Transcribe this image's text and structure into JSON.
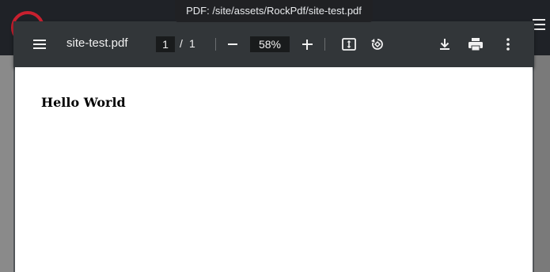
{
  "tooltip": {
    "text": "PDF: /site/assets/RockPdf/site-test.pdf"
  },
  "viewer": {
    "filename": "site-test.pdf",
    "page_current": "1",
    "page_separator": "/",
    "page_total": "1",
    "zoom": "58%"
  },
  "icons": {
    "menu": "hamburger-menu-icon",
    "zoom_out": "minus-icon",
    "zoom_in": "plus-icon",
    "fit": "fit-to-page-icon",
    "rotate": "rotate-counterclockwise-icon",
    "download": "download-icon",
    "print": "print-icon",
    "more": "more-vertical-icon"
  },
  "document": {
    "text": "Hello World"
  },
  "colors": {
    "toolbar": "#323639",
    "page": "#ffffff",
    "logo_ring": "#c8202f"
  }
}
